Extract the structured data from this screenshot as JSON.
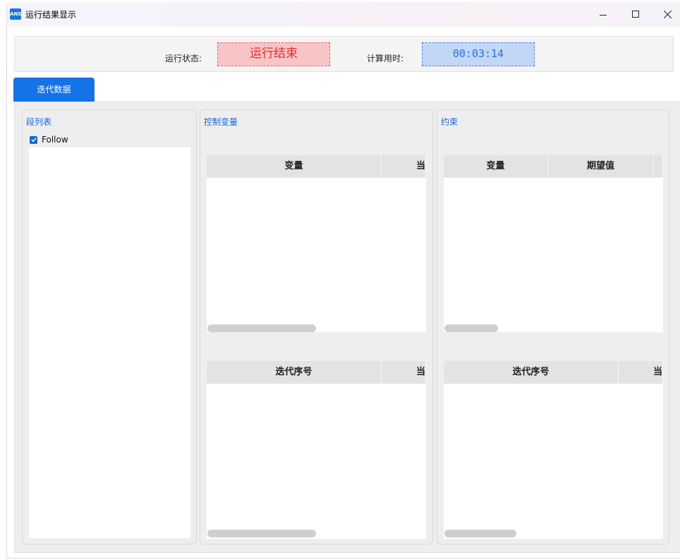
{
  "window": {
    "app_icon_text": "ANS",
    "title": "运行结果显示"
  },
  "status": {
    "run_label": "运行状态:",
    "run_value": "运行结束",
    "time_label": "计算用时:",
    "time_value": "00:03:14"
  },
  "tabs": [
    {
      "label": "迭代数据",
      "active": true
    }
  ],
  "segments": {
    "title": "段列表",
    "items": [
      {
        "label": "Follow",
        "checked": true
      }
    ]
  },
  "control_vars": {
    "title": "控制变量",
    "table_top": {
      "headers": [
        "变量",
        "当"
      ]
    },
    "table_bottom": {
      "headers": [
        "迭代序号",
        "当"
      ]
    }
  },
  "constraints": {
    "title": "约束",
    "table_top": {
      "headers": [
        "变量",
        "期望值",
        ""
      ]
    },
    "table_bottom": {
      "headers": [
        "迭代序号",
        "当"
      ]
    }
  },
  "colors": {
    "accent": "#1473e6",
    "status_run_bg": "#f8c4c6",
    "status_run_text": "#e12c2c",
    "status_time_bg": "#c2d6f6",
    "status_time_text": "#2e6fe0"
  }
}
